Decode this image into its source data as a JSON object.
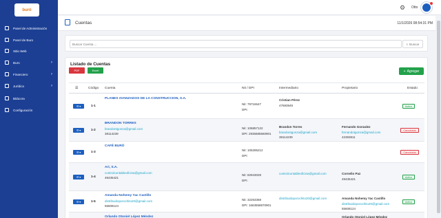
{
  "brand": {
    "logo_text": "buró",
    "logo_sub": "asesores"
  },
  "sidebar": {
    "items": [
      {
        "label": "Panel de Administración",
        "icon": "dashboard-icon",
        "chevron": false
      },
      {
        "label": "Panel de Buro",
        "icon": "panel-icon",
        "chevron": false
      },
      {
        "label": "Sitio Web",
        "icon": "web-icon",
        "chevron": false
      },
      {
        "label": "Buro",
        "icon": "buro-icon",
        "chevron": true
      },
      {
        "label": "Financiero",
        "icon": "finance-icon",
        "chevron": true
      },
      {
        "label": "Jurídico",
        "icon": "legal-icon",
        "chevron": true
      },
      {
        "label": "Bitácora",
        "icon": "log-icon",
        "chevron": false
      },
      {
        "label": "Configuración",
        "icon": "settings-icon",
        "chevron": false
      }
    ]
  },
  "topbar": {
    "user_name": "Otto"
  },
  "header": {
    "title": "Cuentas",
    "datetime": "11/1/2026 08:54:31 PM"
  },
  "search": {
    "placeholder": "Buscar Cuenta ...",
    "button_label": "Buscar"
  },
  "list": {
    "title": "Listado de Cuentas",
    "pdf_label": "PDF",
    "excel_label": "Excel",
    "add_label": "Agregar",
    "columns": {
      "icon": "☰",
      "code": "Código",
      "account": "Cuenta",
      "nit": "Nit / DPI",
      "intermediary": "Intermediario",
      "owner": "Propietario",
      "status": "Estado"
    },
    "rows": [
      {
        "code": "1-1",
        "name": "PLANES AVANZADOS DE LA CONSTRUCCION, S.A.",
        "email": "",
        "phone": "",
        "nit": "Nit: 79716547",
        "dpi": "DPI:",
        "int_name": "Cristian Pérez",
        "int_email": "",
        "int_phone": "47693949",
        "own_name": "",
        "own_email": "",
        "own_phone": "",
        "status": "Activo",
        "status_type": "activo"
      },
      {
        "code": "1-2",
        "name": "BRANDON TORRES",
        "email": "brandontgonza@gmail.com",
        "phone": "38114239",
        "nit": "Nit: 106857122",
        "dpi": "DPI: 2935685560901",
        "int_name": "Brandon Torres",
        "int_email": "brandontgonza@gmail.com",
        "int_phone": "38114239",
        "own_name": "Fernando Gonzalez",
        "own_email": "fernandotgonza@gmail.com",
        "own_phone": "42393811",
        "status": "Cancelada",
        "status_type": "cancel"
      },
      {
        "code": "1-3",
        "name": "CAFÉ BURÓ",
        "email": "",
        "phone": "",
        "nit": "Nit: 105285212",
        "dpi": "DPI:",
        "int_name": "",
        "int_email": "",
        "int_phone": "",
        "own_name": "",
        "own_email": "",
        "own_phone": "",
        "status": "Cancelada",
        "status_type": "cancel"
      },
      {
        "code": "1-4",
        "name": "Ari, S.A.",
        "email": "controlcontableoficina@gmail.com",
        "phone": "49435421",
        "nit": "Nit: 82943028",
        "dpi": "DPI:",
        "int_name": "",
        "int_email": "controlcontableoficina@gmail.com",
        "int_phone": "",
        "own_name": "Cornelio Paz",
        "own_email": "",
        "own_phone": "49435421",
        "status": "Activo",
        "status_type": "activo"
      },
      {
        "code": "1-5",
        "name": "Amanda Nohemy Yac Castillo",
        "email": "distribuidoporochito20@gmail.com",
        "phone": "55608124",
        "nit": "Nit: 32263368",
        "dpi": "DPI: 1663558870901",
        "int_name": "",
        "int_email": "distribuidoporochito20@gmail.com",
        "int_phone": "",
        "own_name": "Amanda Nohemy Yac Castillo",
        "own_email": "distribuidoporochito20@gmail.com",
        "own_phone": "55608124",
        "status": "Activo",
        "status_type": "activo"
      },
      {
        "code": "",
        "name": "Orlando Otoniel López Méndez",
        "email": "",
        "phone": "",
        "nit": "",
        "dpi": "",
        "int_name": "",
        "int_email": "",
        "int_phone": "",
        "own_name": "Orlando Otoniel López Méndez",
        "own_email": "",
        "own_phone": "",
        "status": "",
        "status_type": ""
      }
    ]
  },
  "colors": {
    "sidebar": "#1c3f94",
    "primary": "#1c5fbf",
    "success": "#22a14a",
    "danger": "#d9363e"
  }
}
